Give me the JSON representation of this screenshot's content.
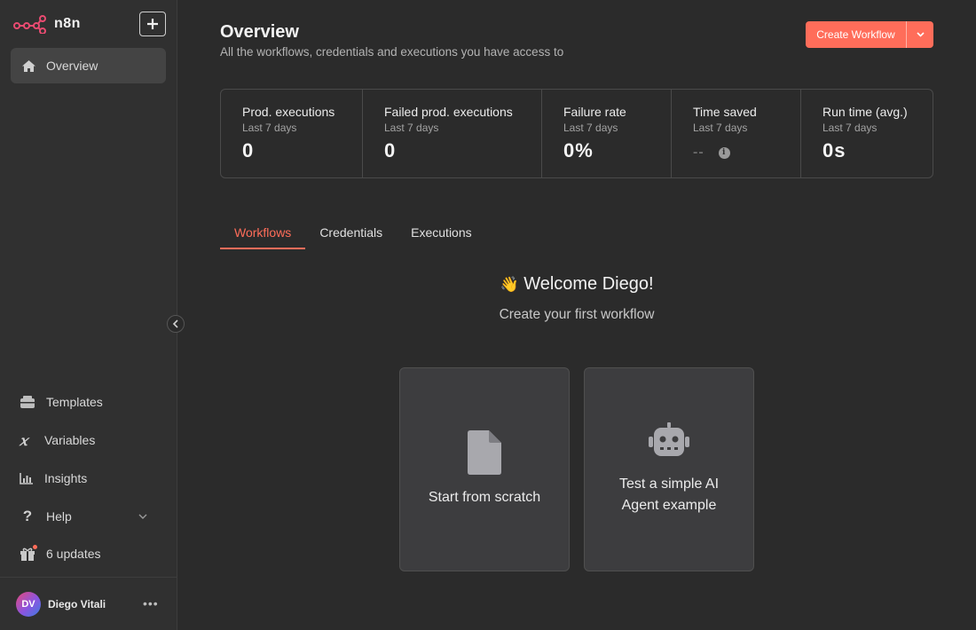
{
  "app": {
    "name": "n8n"
  },
  "sidebar": {
    "overview_label": "Overview",
    "bottom_items": {
      "templates": "Templates",
      "variables": "Variables",
      "insights": "Insights",
      "help": "Help",
      "updates": "6 updates"
    },
    "user": {
      "initials": "DV",
      "name": "Diego Vitali"
    }
  },
  "header": {
    "title": "Overview",
    "subtitle": "All the workflows, credentials and executions you have access to",
    "create_button": "Create Workflow"
  },
  "stats": [
    {
      "title": "Prod. executions",
      "period": "Last 7 days",
      "value": "0"
    },
    {
      "title": "Failed prod. executions",
      "period": "Last 7 days",
      "value": "0"
    },
    {
      "title": "Failure rate",
      "period": "Last 7 days",
      "value": "0%"
    },
    {
      "title": "Time saved",
      "period": "Last 7 days",
      "value": "--"
    },
    {
      "title": "Run time (avg.)",
      "period": "Last 7 days",
      "value": "0s"
    }
  ],
  "tabs": [
    "Workflows",
    "Credentials",
    "Executions"
  ],
  "active_tab": "Workflows",
  "welcome": {
    "emoji": "👋",
    "title": "Welcome Diego!",
    "subtitle": "Create your first workflow"
  },
  "cards": {
    "scratch": "Start from scratch",
    "ai_agent_line1": "Test a simple AI",
    "ai_agent_line2": "Agent example"
  },
  "colors": {
    "accent": "#ff6d5a",
    "background": "#2b2b2b",
    "sidebar": "#303030"
  }
}
